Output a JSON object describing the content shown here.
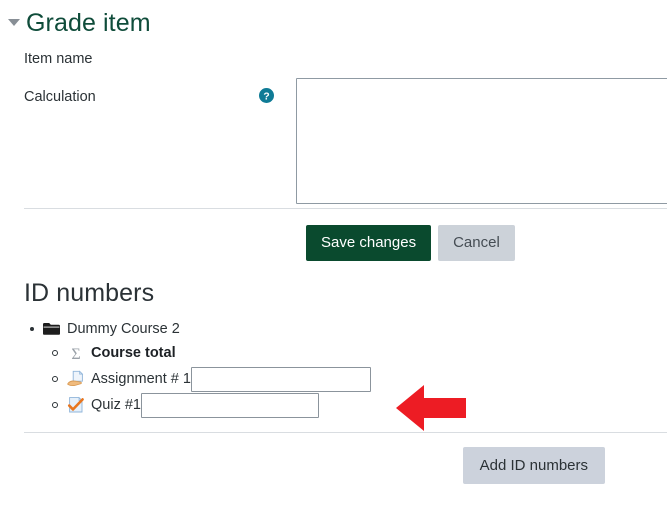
{
  "section": {
    "title": "Grade item",
    "collapse_icon": "chevron-down-icon",
    "expanded": true
  },
  "form": {
    "item_name": {
      "label": "Item name",
      "value": ""
    },
    "calculation": {
      "label": "Calculation",
      "help_icon": "help-circle-icon",
      "value": "",
      "placeholder": ""
    }
  },
  "actions": {
    "save_label": "Save changes",
    "cancel_label": "Cancel"
  },
  "id_numbers": {
    "heading": "ID numbers",
    "tree": {
      "course": {
        "label": "Dummy Course 2",
        "icon": "folder-icon"
      },
      "items": [
        {
          "label": "Course total",
          "icon": "sigma-icon",
          "bold": true,
          "has_input": false,
          "input_value": ""
        },
        {
          "label": "Assignment # 1",
          "icon": "assignment-hand-icon",
          "bold": false,
          "has_input": true,
          "input_value": ""
        },
        {
          "label": "Quiz #1",
          "icon": "quiz-check-icon",
          "bold": false,
          "has_input": true,
          "input_value": ""
        }
      ]
    },
    "add_button_label": "Add ID numbers"
  },
  "annotation": {
    "type": "arrow-left",
    "color": "#ed1c24"
  },
  "colors": {
    "heading_green": "#0f4c3a",
    "primary_button": "#0a4a2e",
    "secondary_button": "#ccd2d9",
    "help_icon": "#0f7b96",
    "annotation_red": "#ed1c24"
  }
}
